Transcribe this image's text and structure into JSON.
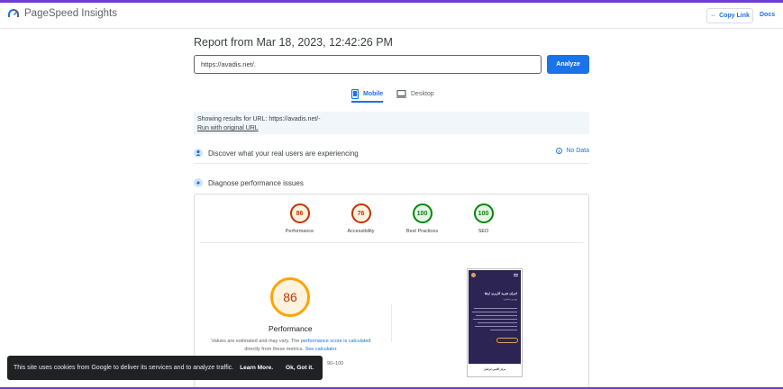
{
  "app": {
    "title": "PageSpeed Insights"
  },
  "header": {
    "copy_link": "Copy Link",
    "docs": "Docs"
  },
  "report": {
    "title": "Report from Mar 18, 2023, 12:42:26 PM",
    "url_value": "https://avadis.net/.",
    "analyze_label": "Analyze"
  },
  "tabs": [
    {
      "label": "Mobile",
      "selected": true
    },
    {
      "label": "Desktop",
      "selected": false
    }
  ],
  "showing": {
    "text": "Showing results for URL: https://avadis.net/",
    "suffix": "-",
    "run_original": "Run with original URL"
  },
  "sections": {
    "discover": "Discover what your real users are experiencing",
    "no_data": "No Data",
    "diagnose": "Diagnose performance issues"
  },
  "scores": [
    {
      "name": "Performance",
      "value": "86",
      "status": "average"
    },
    {
      "name": "Accessibility",
      "value": "76",
      "status": "average"
    },
    {
      "name": "Best Practices",
      "value": "100",
      "status": "pass"
    },
    {
      "name": "SEO",
      "value": "100",
      "status": "pass"
    }
  ],
  "performance": {
    "score": "86",
    "label": "Performance",
    "note_a": "Values are estimated and may vary. The",
    "note_link1": "performance score is calculated",
    "note_b": "directly from these metrics.",
    "note_link2": "See calculator.",
    "range": "90–100"
  },
  "preview": {
    "heading": "اجرای تجربه کاربری ارتقا",
    "sub": "بهترین مشاوره",
    "footer": "مرکز اکادمی ایرانیان"
  },
  "cookie": {
    "text": "This site uses cookies from Google to deliver its services and to analyze traffic.",
    "learn_more": "Learn More.",
    "got_it": "Ok, Got it."
  },
  "colors": {
    "brand": "#1a73e8",
    "average": "#ffa400",
    "pass": "#0cce6b",
    "accent_bar": "#6e3cd6"
  }
}
